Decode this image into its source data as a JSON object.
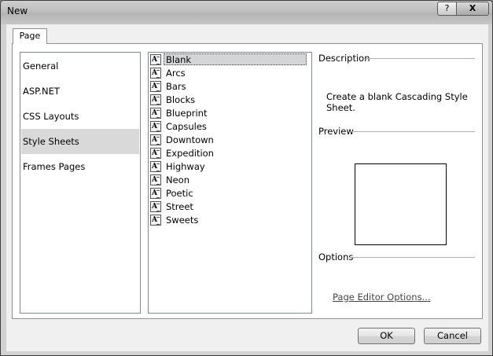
{
  "window": {
    "title": "New",
    "help_label": "?",
    "close_label": "X"
  },
  "tab": {
    "label": "Page"
  },
  "categories": [
    "General",
    "ASP.NET",
    "CSS Layouts",
    "Style Sheets",
    "Frames Pages"
  ],
  "selected_category": "Style Sheets",
  "templates": [
    "Blank",
    "Arcs",
    "Bars",
    "Blocks",
    "Blueprint",
    "Capsules",
    "Downtown",
    "Expedition",
    "Highway",
    "Neon",
    "Poetic",
    "Street",
    "Sweets"
  ],
  "selected_template": "Blank",
  "description": {
    "heading": "Description",
    "text": "Create a blank Cascading Style Sheet."
  },
  "preview": {
    "heading": "Preview"
  },
  "options": {
    "heading": "Options",
    "link": "Page Editor Options..."
  },
  "buttons": {
    "ok": "OK",
    "cancel": "Cancel"
  },
  "icon_glyph": "A"
}
